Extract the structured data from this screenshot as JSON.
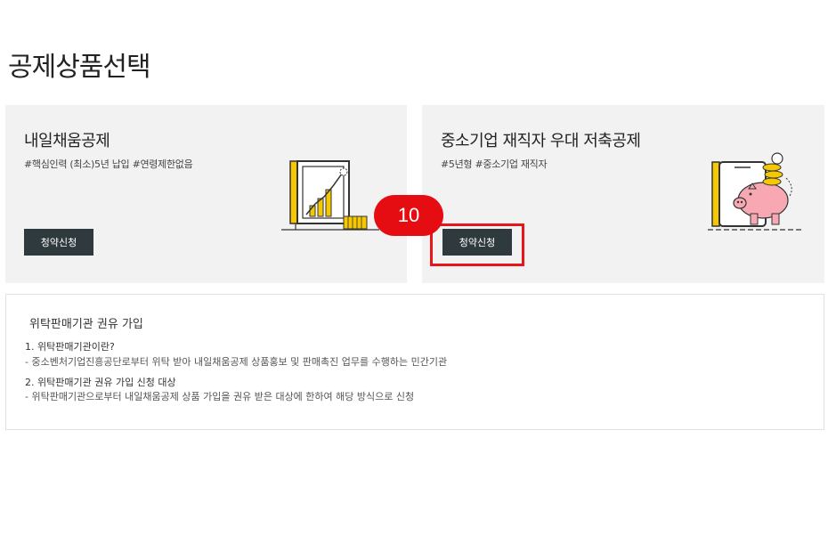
{
  "page": {
    "title": "공제상품선택"
  },
  "products": [
    {
      "name": "내일채움공제",
      "tags": "#핵심인력 (최소)5년 납입 #연령제한없음",
      "button_label": "청약신청"
    },
    {
      "name": "중소기업 재직자 우대 저축공제",
      "tags": "#5년형 #중소기업 재직자",
      "button_label": "청약신청"
    }
  ],
  "annotation": {
    "step_number": "10",
    "color": "#e50d12"
  },
  "info": {
    "heading": "위탁판매기관 권유 가입",
    "items": [
      {
        "question": "1. 위탁판매기관이란?",
        "answer": "- 중소벤처기업진흥공단로부터 위탁 받아 내일채움공제 상품홍보 및 판매촉진 업무를 수행하는 민간기관"
      },
      {
        "question": "2. 위탁판매기관 권유 가입 신청 대상",
        "answer": "- 위탁판매기관으로부터 내일채움공제 상품 가입을 권유 받은 대상에 한하여 해당 방식으로 신청"
      }
    ]
  },
  "colors": {
    "button_bg": "#2e3a3e",
    "card_bg": "#f2f2f2",
    "accent_yellow": "#f5c800",
    "piggy_pink": "#f7a8b3"
  },
  "icons": {
    "chart": "growth-chart-illustration",
    "piggy": "piggy-bank-illustration"
  }
}
